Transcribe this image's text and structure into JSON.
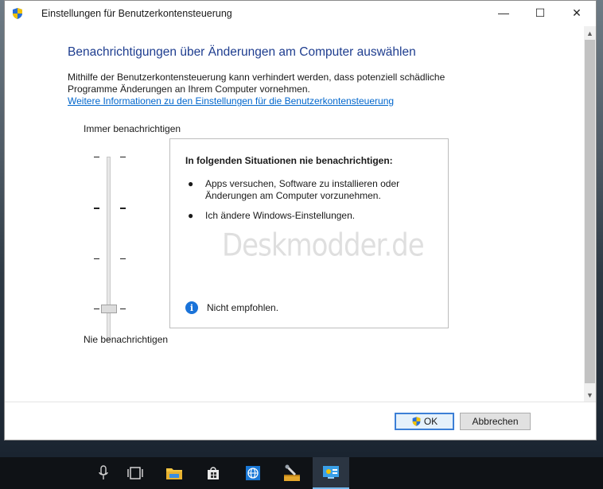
{
  "window": {
    "title": "Einstellungen für Benutzerkontensteuerung",
    "controls": {
      "minimize": "—",
      "maximize": "☐",
      "close": "✕"
    }
  },
  "main": {
    "heading": "Benachrichtigungen über Änderungen am Computer auswählen",
    "description": "Mithilfe der Benutzerkontensteuerung kann verhindert werden, dass potenziell schädliche Programme Änderungen an Ihrem Computer vornehmen.",
    "link": "Weitere Informationen zu den Einstellungen für die Benutzerkontensteuerung"
  },
  "slider": {
    "label_top": "Immer benachrichtigen",
    "label_bottom": "Nie benachrichtigen",
    "levels": 4,
    "current_level": 1
  },
  "info_box": {
    "title": "In folgenden Situationen nie benachrichtigen:",
    "bullets": [
      "Apps versuchen, Software zu installieren oder Änderungen am Computer vorzunehmen.",
      "Ich ändere Windows-Einstellungen."
    ],
    "watermark": "Deskmodder.de",
    "note": "Nicht empfohlen."
  },
  "footer": {
    "ok_label": "OK",
    "cancel_label": "Abbrechen"
  },
  "scrollbar": {
    "up": "▲",
    "down": "▼"
  },
  "icons": {
    "title": "uac-shield-icon",
    "ok": "uac-shield-icon",
    "note": "info-icon",
    "taskbar": [
      "microphone-icon",
      "task-view-icon",
      "file-explorer-icon",
      "store-icon",
      "browser-icon",
      "tool-icon",
      "control-panel-icon"
    ]
  },
  "colors": {
    "heading": "#1e3d8f",
    "link": "#0066cc",
    "info": "#1a73d9",
    "ok_border": "#3c7fd6",
    "taskbar": "#0f1216"
  }
}
